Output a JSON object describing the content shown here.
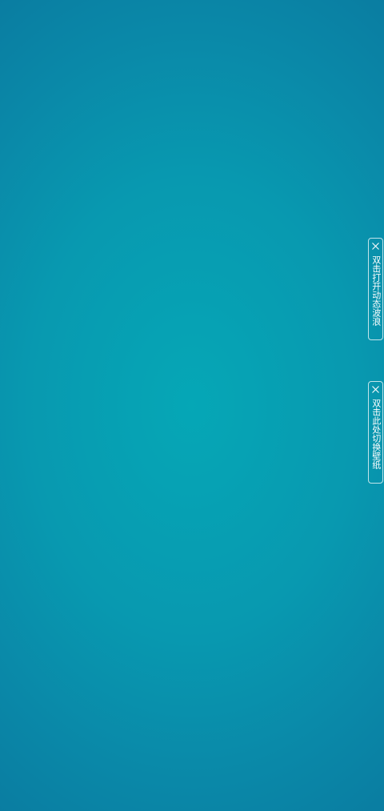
{
  "background": {
    "center_color": "#05a7b6",
    "edge_color": "#0a7ba0"
  },
  "side_tabs": [
    {
      "icon": "close-icon",
      "label": "双击打开动态波浪"
    },
    {
      "icon": "close-icon",
      "label": "双击此处切换壁纸"
    }
  ]
}
